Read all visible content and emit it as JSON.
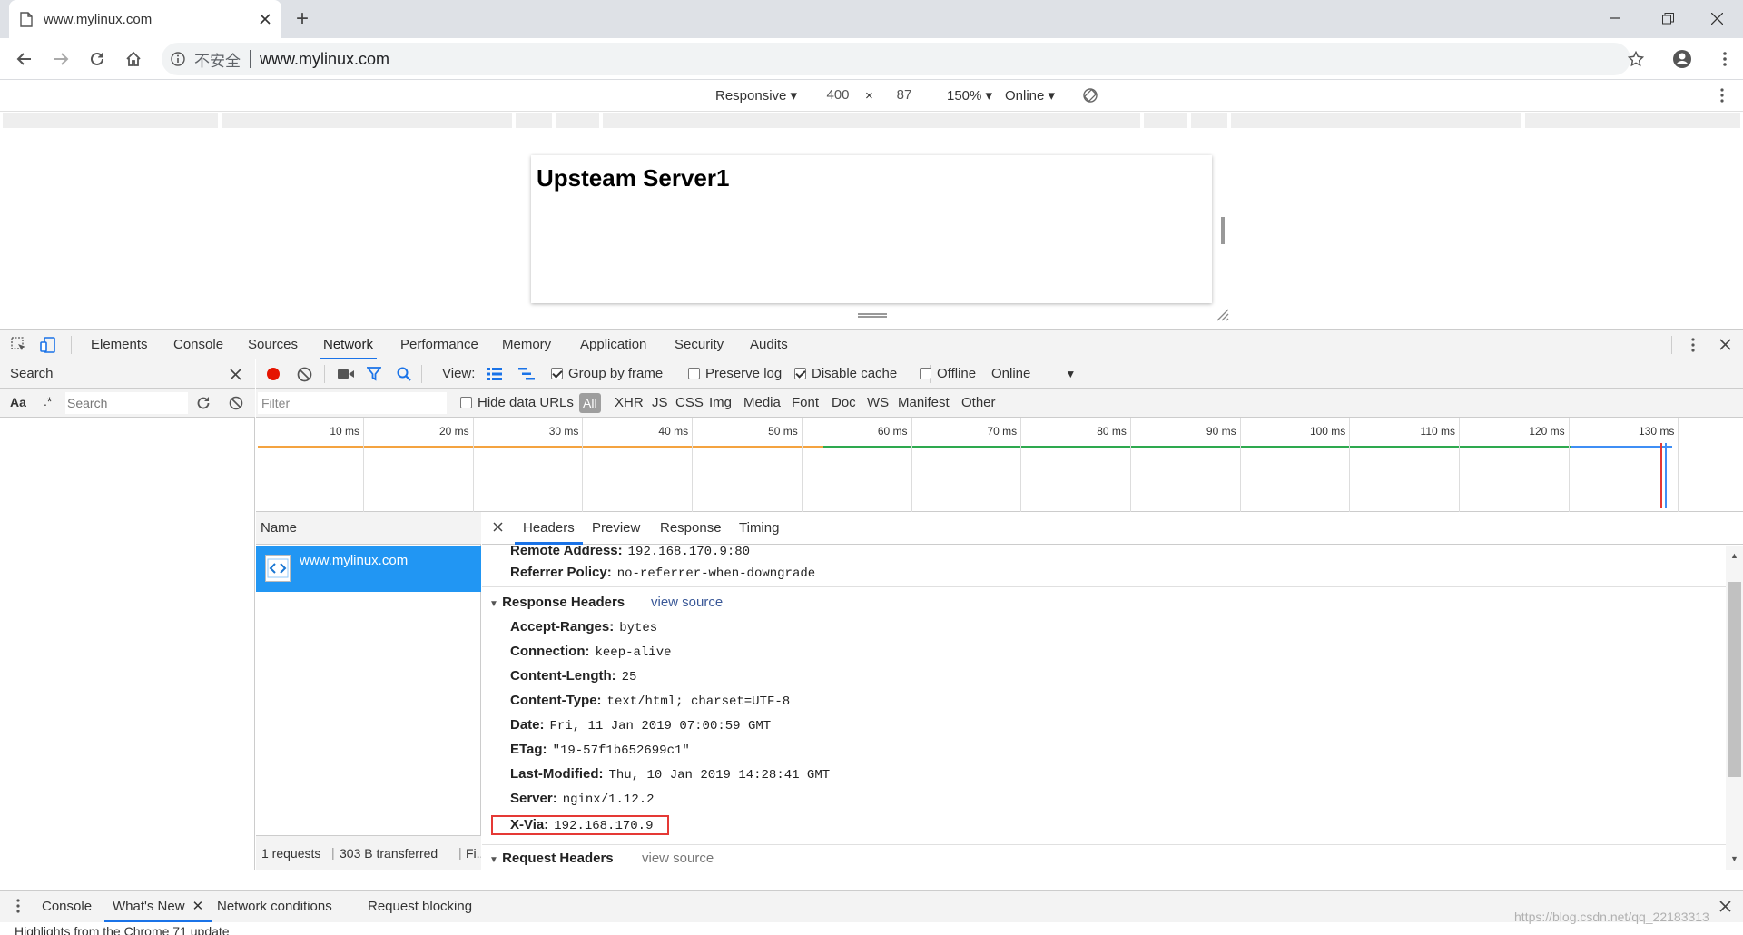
{
  "browser": {
    "tab_title": "www.mylinux.com",
    "security_label": "不安全",
    "url": "www.mylinux.com"
  },
  "device_toolbar": {
    "device": "Responsive",
    "width": "400",
    "times": "×",
    "height": "87",
    "zoom": "150%",
    "throttle": "Online"
  },
  "page": {
    "heading": "Upsteam Server1"
  },
  "devtools": {
    "tabs": [
      "Elements",
      "Console",
      "Sources",
      "Network",
      "Performance",
      "Memory",
      "Application",
      "Security",
      "Audits"
    ],
    "active_tab": "Network",
    "search_panel": {
      "title": "Search",
      "case_label": "Aa",
      "regex_label": ".*",
      "input_placeholder": "Search"
    },
    "network_toolbar": {
      "view_label": "View:",
      "group_by_frame": "Group by frame",
      "preserve_log": "Preserve log",
      "disable_cache": "Disable cache",
      "offline": "Offline",
      "throttle": "Online"
    },
    "filter_bar": {
      "placeholder": "Filter",
      "hide_data_urls": "Hide data URLs",
      "types": [
        "All",
        "XHR",
        "JS",
        "CSS",
        "Img",
        "Media",
        "Font",
        "Doc",
        "WS",
        "Manifest",
        "Other"
      ]
    },
    "timeline_ticks": [
      "10 ms",
      "20 ms",
      "30 ms",
      "40 ms",
      "50 ms",
      "60 ms",
      "70 ms",
      "80 ms",
      "90 ms",
      "100 ms",
      "110 ms",
      "120 ms",
      "130 ms"
    ],
    "request_list": {
      "column": "Name",
      "requests": [
        "www.mylinux.com"
      ],
      "summary": "1 requests",
      "transferred": "303 B transferred",
      "finish": "Fi..."
    },
    "details": {
      "tabs": [
        "Headers",
        "Preview",
        "Response",
        "Timing"
      ],
      "general": [
        {
          "key": "Remote Address:",
          "value": "192.168.170.9:80"
        },
        {
          "key": "Referrer Policy:",
          "value": "no-referrer-when-downgrade"
        }
      ],
      "response_section": "Response Headers",
      "view_source": "view source",
      "response_headers": [
        {
          "key": "Accept-Ranges:",
          "value": "bytes"
        },
        {
          "key": "Connection:",
          "value": "keep-alive"
        },
        {
          "key": "Content-Length:",
          "value": "25"
        },
        {
          "key": "Content-Type:",
          "value": "text/html; charset=UTF-8"
        },
        {
          "key": "Date:",
          "value": "Fri, 11 Jan 2019 07:00:59 GMT"
        },
        {
          "key": "ETag:",
          "value": "\"19-57f1b652699c1\""
        },
        {
          "key": "Last-Modified:",
          "value": "Thu, 10 Jan 2019 14:28:41 GMT"
        },
        {
          "key": "Server:",
          "value": "nginx/1.12.2"
        },
        {
          "key": "X-Via:",
          "value": "192.168.170.9"
        }
      ],
      "request_section": "Request Headers"
    },
    "drawer": {
      "tabs": [
        "Console",
        "What's New",
        "Network conditions",
        "Request blocking"
      ],
      "active": "What's New",
      "body_text": "Highlights from the Chrome 71 update"
    }
  },
  "watermark": "https://blog.csdn.net/qq_22183313",
  "colors": {
    "accent": "#1a73e8",
    "selected_row": "#2196f3",
    "highlight_box": "#e53935",
    "record": "#e51400",
    "timeline_orange": "#f4a340",
    "timeline_green": "#2ea94f",
    "timeline_blue": "#3f8ef5"
  }
}
